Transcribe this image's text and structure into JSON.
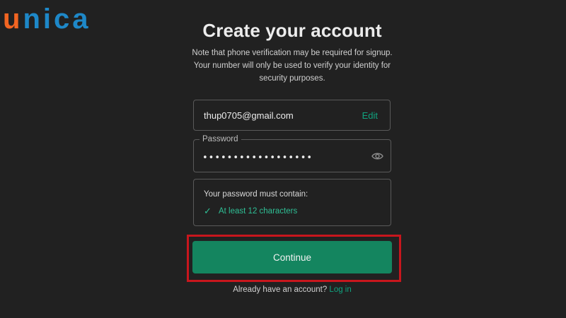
{
  "brand": {
    "logo_text": "unica",
    "logo_colors": {
      "u": "#f26522",
      "rest": "#1e88c8"
    }
  },
  "form": {
    "title": "Create your account",
    "subtitle": "Note that phone verification may be required for signup. Your number will only be used to verify your identity for security purposes.",
    "email_value": "thup0705@gmail.com",
    "edit_label": "Edit",
    "password_label": "Password",
    "password_value": "••••••••••••••••••",
    "password_icon": "eye-icon",
    "requirements_heading": "Your password must contain:",
    "requirement_item": "At least 12 characters",
    "requirement_icon": "check-icon",
    "continue_label": "Continue",
    "login_prompt": "Already have an account?",
    "login_link": "Log in"
  },
  "colors": {
    "background": "#212121",
    "accent": "#10a37f",
    "button": "#14855f",
    "highlight": "#c8161d"
  }
}
